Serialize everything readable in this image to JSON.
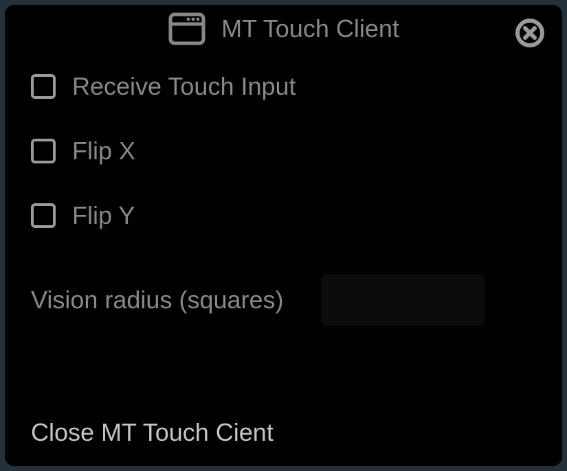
{
  "window": {
    "title": "MT Touch Client"
  },
  "options": {
    "receive_touch_input": {
      "label": "Receive Touch Input",
      "checked": false
    },
    "flip_x": {
      "label": "Flip X",
      "checked": false
    },
    "flip_y": {
      "label": "Flip Y",
      "checked": false
    }
  },
  "vision_radius": {
    "label": "Vision radius (squares)",
    "value": ""
  },
  "close_link": {
    "label": "Close MT Touch Cient"
  }
}
